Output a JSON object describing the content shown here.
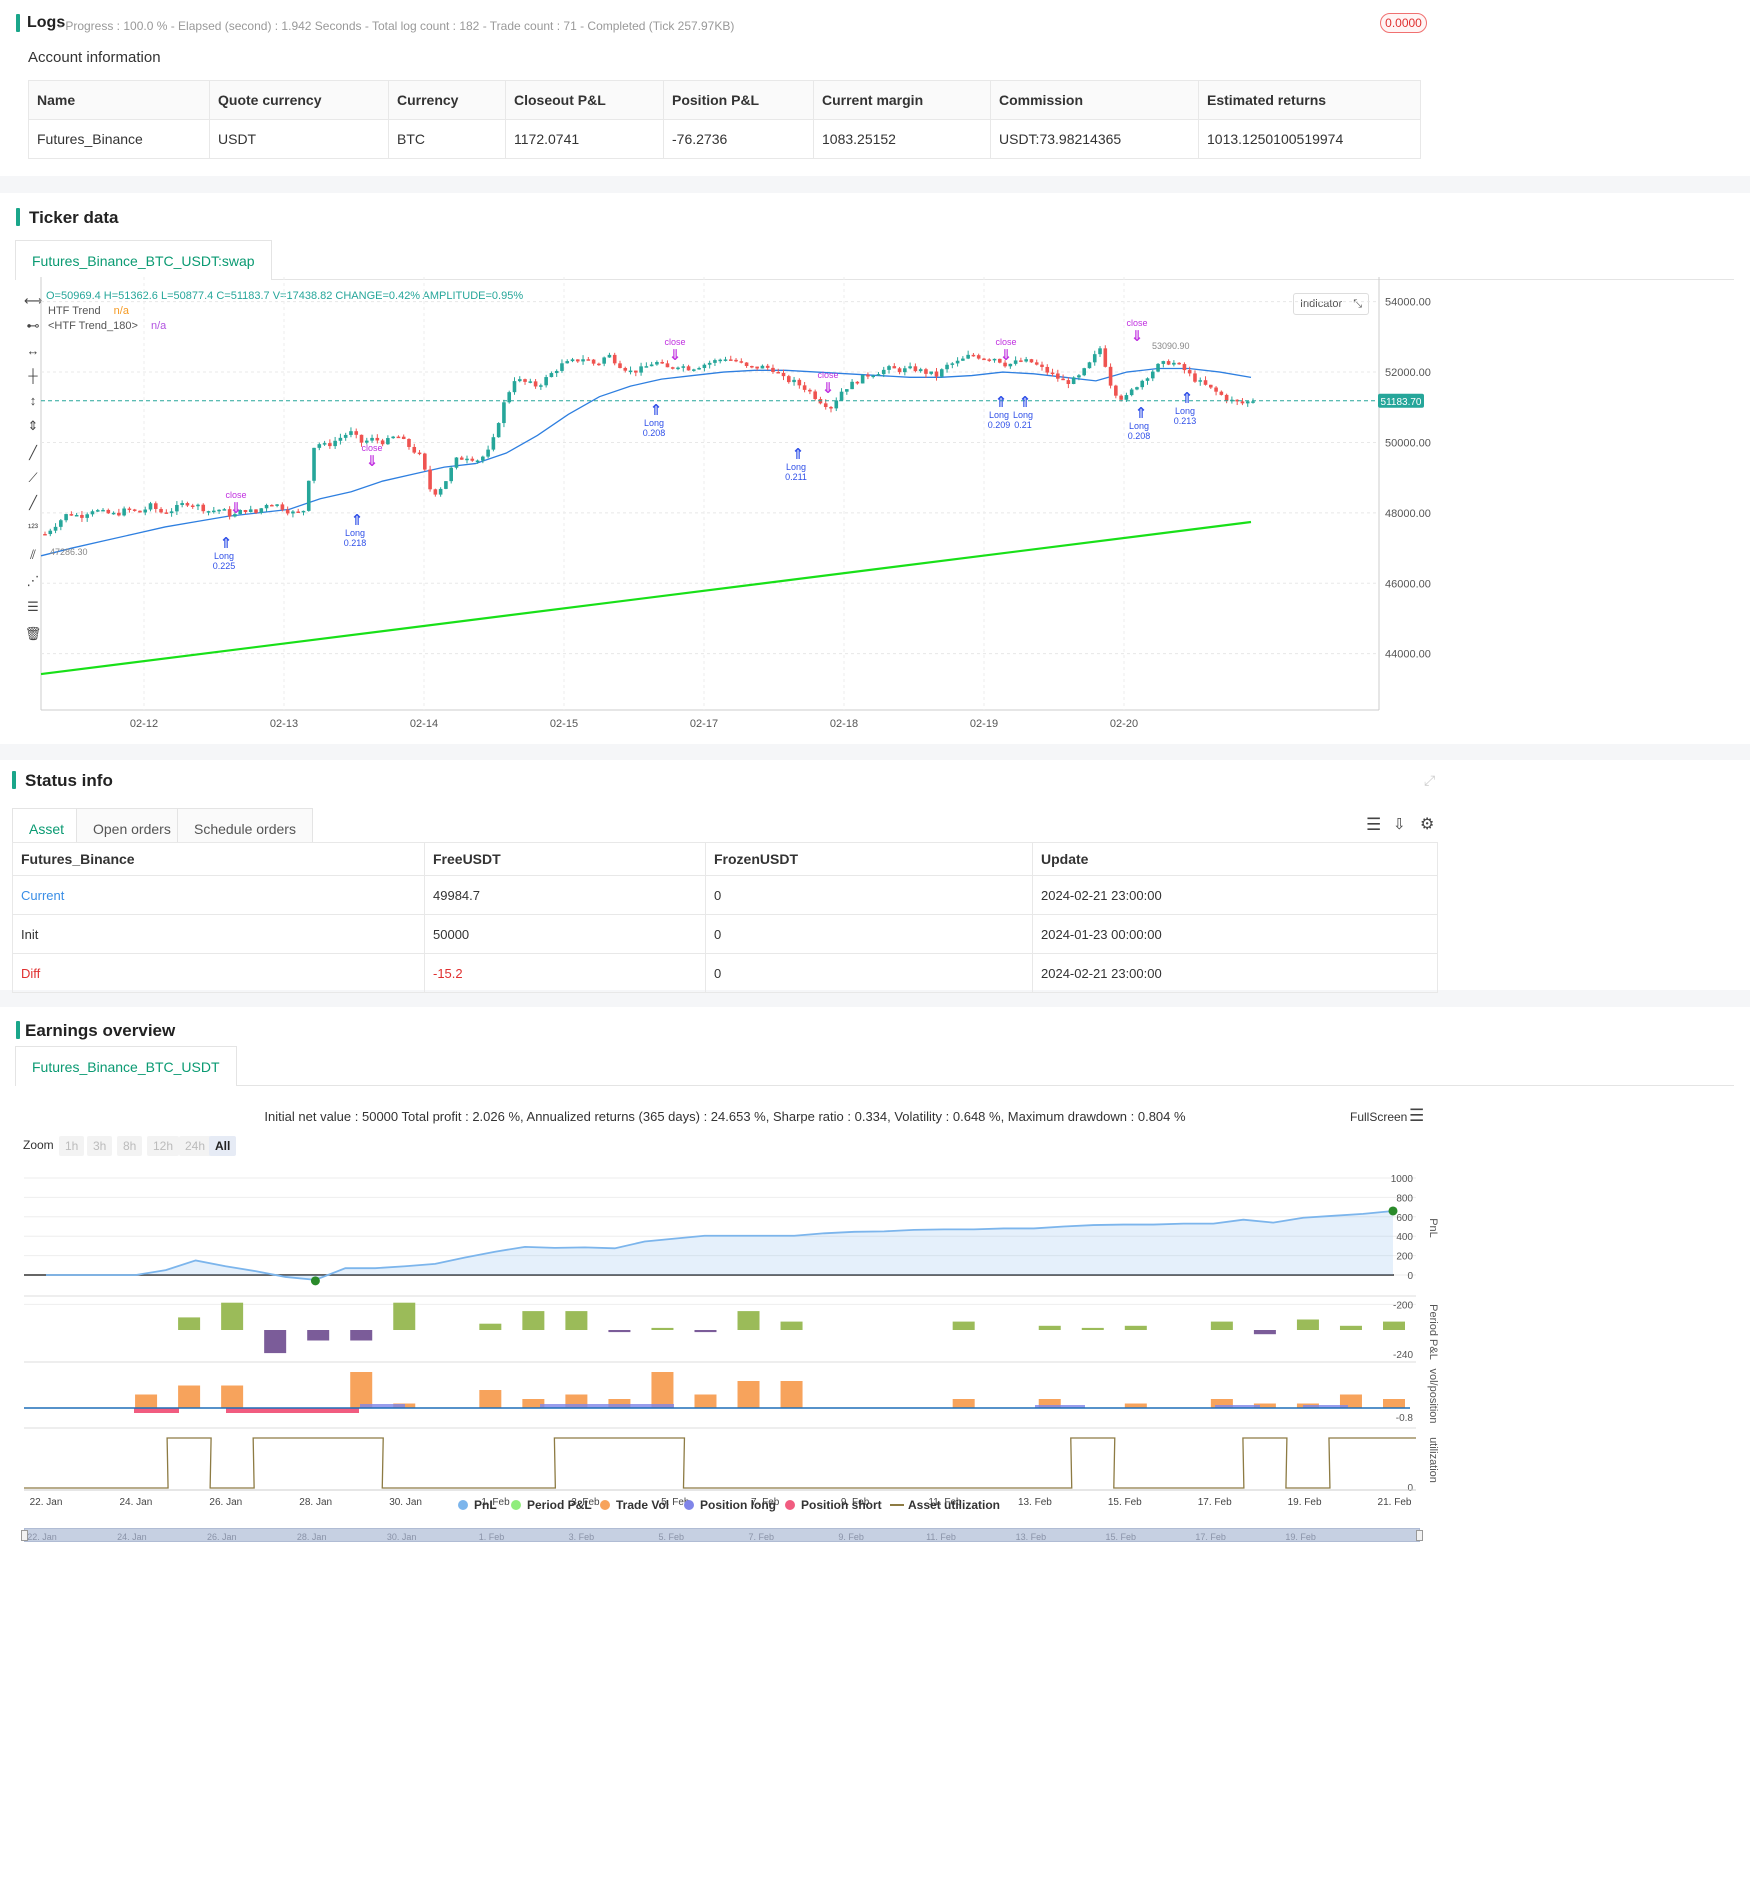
{
  "logs": {
    "title": "Logs",
    "summary": "- Progress : 100.0 % - Elapsed (second) : 1.942  Seconds - Total log count : 182 - Trade count : 71 - Completed (Tick 257.97KB)",
    "badge": "0.0000"
  },
  "account": {
    "heading": "Account information",
    "columns": [
      "Name",
      "Quote currency",
      "Currency",
      "Closeout P&L",
      "Position P&L",
      "Current margin",
      "Commission",
      "Estimated returns"
    ],
    "row": [
      "Futures_Binance",
      "USDT",
      "BTC",
      "1172.0741",
      "-76.2736",
      "1083.25152",
      "USDT:73.98214365",
      "1013.1250100519974"
    ]
  },
  "ticker": {
    "title": "Ticker data",
    "tab": "Futures_Binance_BTC_USDT:swap",
    "ohlc": "O=50969.4 H=51362.6 L=50877.4 C=51183.7 V=17438.82 CHANGE=0.42% AMPLITUDE=0.95%",
    "legend": [
      {
        "label": "HTF Trend",
        "value": "n/a",
        "color": "#f59a23"
      },
      {
        "label": "<HTF Trend_180>",
        "value": "n/a",
        "color": "#b152e0"
      }
    ],
    "indicator_button": "Indicator",
    "price_label": "51183.70",
    "low_label": "47286.30",
    "high_label": "53090.90",
    "colors": {
      "up": "#26a69a",
      "down": "#ef5350",
      "htf": "#2e7fe0",
      "trend180": "#18e018",
      "long": "#3050e8",
      "close": "#c030e0"
    },
    "chart_data": {
      "type": "candlestick",
      "x_ticks": [
        "02-12",
        "02-13",
        "02-14",
        "02-15",
        "02-17",
        "02-18",
        "02-19",
        "02-20"
      ],
      "y_ticks": [
        "54000.00",
        "52000.00",
        "50000.00",
        "48000.00",
        "46000.00",
        "44000.00"
      ],
      "ylim": [
        42400,
        54700
      ],
      "close_series": [
        47400,
        47700,
        48000,
        47900,
        48100,
        48000,
        47950,
        48100,
        48000,
        48200,
        48000,
        48100,
        48300,
        48200,
        48050,
        48100,
        47900,
        48100,
        48000,
        48300,
        48200,
        48000,
        48000,
        50000,
        49900,
        50100,
        50300,
        50000,
        50100,
        50000,
        50200,
        49900,
        49600,
        48500,
        48800,
        49500,
        49600,
        49500,
        49800,
        51000,
        51800,
        51700,
        51600,
        51900,
        52200,
        52300,
        52400,
        52200,
        52500,
        52200,
        52000,
        52100,
        52300,
        52100,
        52200,
        52100,
        52200,
        52300,
        52400,
        52300,
        52100,
        52150,
        52100,
        51800,
        51700,
        51500,
        51200,
        51000,
        51500,
        51700,
        51900,
        52000,
        52100,
        52050,
        52100,
        52000,
        51900,
        52200,
        52300,
        52500,
        52400,
        52400,
        52200,
        52300,
        52300,
        52100,
        51900,
        51700,
        51800,
        52200,
        52700,
        51500,
        51200,
        51600,
        51900,
        52200,
        52300,
        52100,
        51800,
        51600,
        51400,
        51200,
        51100,
        51200
      ],
      "htf_trend": [
        46780,
        47000,
        47200,
        47400,
        47600,
        47750,
        47900,
        48000,
        48100,
        48400,
        48600,
        48900,
        49100,
        49300,
        49400,
        49700,
        50200,
        50800,
        51300,
        51600,
        51800,
        51900,
        52000,
        52050,
        52050,
        52000,
        51950,
        51900,
        51850,
        51850,
        51900,
        52000,
        51950,
        51850,
        51750,
        52000,
        52100,
        52100,
        52000,
        51850
      ],
      "htf_trend_180": [
        43420,
        47740
      ]
    },
    "markers": [
      {
        "type": "long",
        "label": "Long",
        "qty": "0.225"
      },
      {
        "type": "close",
        "label": "close",
        "qty": ""
      },
      {
        "type": "long",
        "label": "Long",
        "qty": "0.218"
      },
      {
        "type": "close",
        "label": "close",
        "qty": ""
      },
      {
        "type": "long",
        "label": "Long",
        "qty": "0.208"
      },
      {
        "type": "close",
        "label": "close",
        "qty": ""
      },
      {
        "type": "long",
        "label": "Long",
        "qty": "0.211"
      },
      {
        "type": "close",
        "label": "close",
        "qty": ""
      },
      {
        "type": "long",
        "label": "Long",
        "qty": "0.209"
      },
      {
        "type": "long",
        "label": "Long",
        "qty": "0.21"
      },
      {
        "type": "close",
        "label": "close",
        "qty": ""
      },
      {
        "type": "long",
        "label": "Long",
        "qty": "0.208"
      },
      {
        "type": "close",
        "label": "close",
        "qty": ""
      },
      {
        "type": "long",
        "label": "Long",
        "qty": "0.213"
      }
    ]
  },
  "status": {
    "title": "Status info",
    "tabs": [
      "Asset",
      "Open orders",
      "Schedule orders"
    ],
    "columns": [
      "Futures_Binance",
      "FreeUSDT",
      "FrozenUSDT",
      "Update"
    ],
    "rows": [
      [
        "Current",
        "49984.7",
        "0",
        "2024-02-21 23:00:00"
      ],
      [
        "Init",
        "50000",
        "0",
        "2024-01-23 00:00:00"
      ],
      [
        "Diff",
        "-15.2",
        "0",
        "2024-02-21 23:00:00"
      ]
    ]
  },
  "earnings": {
    "title": "Earnings overview",
    "tab": "Futures_Binance_BTC_USDT",
    "summary": "Initial net value : 50000 Total profit : 2.026 %, Annualized returns (365 days) : 24.653 %, Sharpe ratio : 0.334, Volatility : 0.648 %, Maximum drawdown : 0.804 %",
    "fullscreen": "FullScreen",
    "zoom_label": "Zoom",
    "zoom_options": [
      "1h",
      "3h",
      "8h",
      "12h",
      "24h",
      "All"
    ],
    "axis_titles": [
      "PnL",
      "Period P&L",
      "vol/position",
      "utilization"
    ],
    "pnl_ticks": [
      "1000",
      "800",
      "600",
      "400",
      "200",
      "0",
      "-200"
    ],
    "period_tick": "-240",
    "vol_tick": "-0.8",
    "util_tick": "0",
    "x_ticks": [
      "22. Jan",
      "24. Jan",
      "26. Jan",
      "28. Jan",
      "30. Jan",
      "1. Feb",
      "3. Feb",
      "5. Feb",
      "7. Feb",
      "9. Feb",
      "11. Feb",
      "13. Feb",
      "15. Feb",
      "17. Feb",
      "19. Feb",
      "21. Feb"
    ],
    "legend": [
      {
        "label": "PnL",
        "color": "#7cb5ec"
      },
      {
        "label": "Period P&L",
        "color": "#90ed7d"
      },
      {
        "label": "Trade Vol",
        "color": "#f7a35c"
      },
      {
        "label": "Position long",
        "color": "#8085e9"
      },
      {
        "label": "Position short",
        "color": "#f15c80"
      },
      {
        "label": "Asset utilization",
        "color": "#8d7b43"
      }
    ],
    "chart_data": {
      "type": "line",
      "pnl": [
        0,
        0,
        0,
        0,
        50,
        150,
        90,
        40,
        -20,
        -50,
        70,
        70,
        90,
        115,
        180,
        240,
        290,
        280,
        285,
        275,
        345,
        375,
        405,
        405,
        405,
        405,
        430,
        445,
        450,
        465,
        470,
        470,
        480,
        480,
        500,
        515,
        520,
        520,
        530,
        530,
        570,
        540,
        590,
        610,
        630,
        660
      ],
      "period_pnl": [
        0,
        0,
        0,
        30,
        65,
        -55,
        -25,
        -25,
        65,
        0,
        15,
        45,
        45,
        -5,
        5,
        -5,
        45,
        20,
        0,
        0,
        0,
        20,
        0,
        10,
        5,
        10,
        0,
        20,
        -10,
        25,
        10,
        20
      ],
      "trade_vol": [
        0,
        0,
        0.3,
        0.5,
        0.5,
        0,
        0,
        0.8,
        0.1,
        0,
        0.4,
        0.2,
        0.3,
        0.2,
        0.8,
        0.3,
        0.6,
        0.6,
        0,
        0,
        0,
        0.2,
        0,
        0.2,
        0,
        0.1,
        0,
        0.2,
        0.1,
        0.1,
        0.3,
        0.2
      ],
      "utilization": [
        0,
        0,
        0,
        1,
        0,
        1,
        1,
        1,
        0,
        0,
        0,
        0,
        1,
        1,
        1,
        0,
        0,
        0,
        0,
        0,
        0,
        0,
        0,
        0,
        1,
        0,
        0,
        0,
        1,
        0,
        1,
        1
      ]
    }
  }
}
